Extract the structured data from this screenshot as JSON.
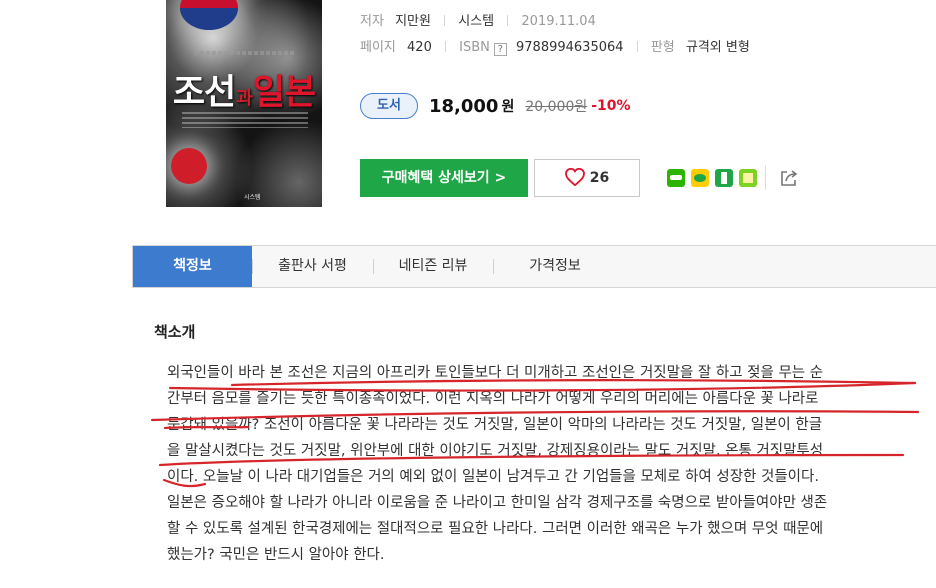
{
  "book": {
    "cover_title_a": "조선",
    "cover_title_connector": "과",
    "cover_title_b": "일본",
    "cover_publisher": "시스템"
  },
  "meta": {
    "author_label": "저자",
    "author": "지만원",
    "publisher": "시스템",
    "date": "2019.11.04",
    "pages_label": "페이지",
    "pages": "420",
    "isbn_label": "ISBN",
    "isbn_help": "?",
    "isbn": "9788994635064",
    "format_label": "판형",
    "format": "규격외 변형"
  },
  "price": {
    "badge": "도서",
    "sale": "18,000",
    "unit": "원",
    "original": "20,000원",
    "discount": "-10%"
  },
  "actions": {
    "buy_label": "구매혜택 상세보기 >",
    "like_count": "26"
  },
  "tabs": [
    {
      "label": "책정보"
    },
    {
      "label": "출판사 서평"
    },
    {
      "label": "네티즌 리뷰"
    },
    {
      "label": "가격정보"
    }
  ],
  "intro": {
    "title": "책소개",
    "lines": [
      "외국인들이 바라 본 조선은 지금의 아프리카 토인들보다 더 미개하고 조선인은 거짓말을 잘 하고 젖을 무는 순",
      "간부터 음모를 즐기는 듯한 특이종족이었다. 이런 지옥의 나라가 어떻게 우리의 머리에는 아름다운 꽃 나라로",
      "둔갑돼 있을까? 조선이 아름다운 꽃 나라라는 것도 거짓말, 일본이 악마의 나라라는 것도 거짓말, 일본이 한글",
      "을 말살시켰다는 것도 거짓말, 위안부에 대한 이야기도 거짓말, 강제징용이라는 말도 거짓말, 온통 거짓말투성",
      "이다. 오늘날 이 나라 대기업들은 거의 예외 없이 일본이 남겨두고 간 기업들을 모체로 하여 성장한 것들이다.",
      "일본은 증오해야 할 나라가 아니라 이로움을 준 나라이고 한미일 삼각 경제구조를 숙명으로 받아들여야만 생존",
      "할 수 있도록 설계된 한국경제에는 절대적으로 필요한 나라다. 그러면 이러한 왜곡은 누가 했으며 무엇 때문에",
      "했는가? 국민은 반드시 알아야 한다."
    ]
  },
  "colors": {
    "accent_blue": "#3d7bcf",
    "buy_green": "#1ea647",
    "discount_red": "#e0142b",
    "underline_red": "#d7262b"
  }
}
